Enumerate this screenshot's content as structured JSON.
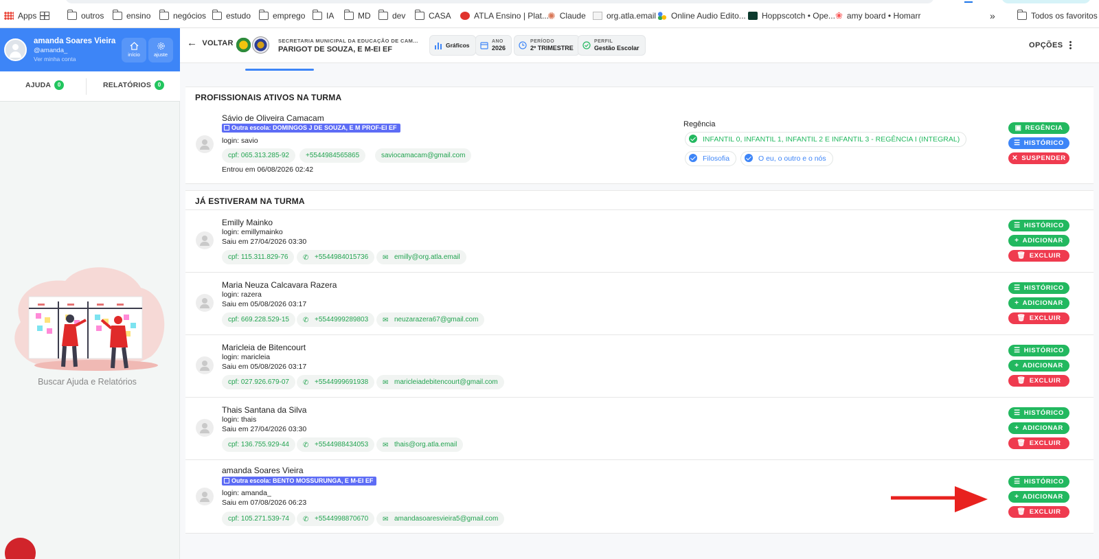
{
  "bookmarks": [
    {
      "label": "Apps",
      "icon": "apps-grid-icon"
    },
    {
      "label": "",
      "icon": "grid-icon"
    },
    {
      "label": "outros",
      "icon": "folder-icon"
    },
    {
      "label": "ensino",
      "icon": "folder-icon"
    },
    {
      "label": "negócios",
      "icon": "folder-icon"
    },
    {
      "label": "estudo",
      "icon": "folder-icon"
    },
    {
      "label": "emprego",
      "icon": "folder-icon"
    },
    {
      "label": "IA",
      "icon": "folder-icon"
    },
    {
      "label": "MD",
      "icon": "folder-icon"
    },
    {
      "label": "dev",
      "icon": "folder-icon"
    },
    {
      "label": "CASA",
      "icon": "folder-icon"
    },
    {
      "label": "ATLA Ensino | Plat...",
      "icon": "atla-icon"
    },
    {
      "label": "Claude",
      "icon": "claude-icon"
    },
    {
      "label": "org.atla.email",
      "icon": "mail-icon"
    },
    {
      "label": "Online Audio Edito...",
      "icon": "audio-icon"
    },
    {
      "label": "Hoppscotch • Ope...",
      "icon": "hoppscotch-icon"
    },
    {
      "label": "amy board • Homarr",
      "icon": "homarr-icon"
    },
    {
      "label": "»",
      "icon": "overflow-icon"
    },
    {
      "label": "Todos os favoritos",
      "icon": "folder-icon"
    }
  ],
  "profile": {
    "name": "amanda Soares Vieira",
    "username": "@amanda_",
    "see_account": "Ver minha conta",
    "home_label": "início",
    "settings_label": "ajuste"
  },
  "help": {
    "help_label": "AJUDA",
    "help_count": "0",
    "reports_label": "RELATÓRIOS",
    "reports_count": "0",
    "search_text": "Buscar Ajuda e Relatórios"
  },
  "header": {
    "back_label": "VOLTAR",
    "org_title": "SECRETARIA MUNICIPAL DA EDUCAÇÃO DE CAM...",
    "org_name": "PARIGOT DE SOUZA, E M-EI EF",
    "chips": {
      "graphs": "Gráficos",
      "year_label": "ANO",
      "year_value": "2026",
      "period_label": "PERÍODO",
      "period_value": "2º TRIMESTRE",
      "profile_label": "PERFIL",
      "profile_value": "Gestão Escolar"
    },
    "options_label": "OPÇÕES"
  },
  "active_section": {
    "title": "PROFISSIONAIS ATIVOS NA TURMA",
    "person": {
      "name": "Sávio de Oliveira Camacam",
      "school_tag": "Outra escola: DOMINGOS J DE SOUZA, E M PROF-EI EF",
      "login": "login: savio",
      "cpf": "cpf: 065.313.285-92",
      "phone": "+5544984565865",
      "email": "saviocamacam@gmail.com",
      "entered": "Entrou em 06/08/2026 02:42",
      "regencia_label": "Regência",
      "regencia_class": "INFANTIL 0, INFANTIL 1, INFANTIL 2 E INFANTIL 3 - REGÊNCIA I (INTEGRAL)",
      "subject_1": "Filosofia",
      "subject_2": "O eu, o outro e o nós",
      "btn_regencia": "REGÊNCIA",
      "btn_historico": "HISTÓRICO",
      "btn_suspender": "SUSPENDER"
    }
  },
  "past_section": {
    "title": "JÁ ESTIVERAM NA TURMA",
    "buttons": {
      "historico": "HISTÓRICO",
      "adicionar": "ADICIONAR",
      "excluir": "EXCLUIR"
    },
    "people": [
      {
        "name": "Emilly Mainko",
        "login": "login: emillymainko",
        "left": "Saiu em 27/04/2026 03:30",
        "cpf": "cpf: 115.311.829-76",
        "phone": "+5544984015736",
        "email": "emilly@org.atla.email"
      },
      {
        "name": "Maria Neuza Calcavara Razera",
        "login": "login: razera",
        "left": "Saiu em 05/08/2026 03:17",
        "cpf": "cpf: 669.228.529-15",
        "phone": "+5544999289803",
        "email": "neuzarazera67@gmail.com"
      },
      {
        "name": "Maricleia de Bitencourt",
        "login": "login: maricleia",
        "left": "Saiu em 05/08/2026 03:17",
        "cpf": "cpf: 027.926.679-07",
        "phone": "+5544999691938",
        "email": "maricleiadebitencourt@gmail.com"
      },
      {
        "name": "Thais Santana da Silva",
        "login": "login: thais",
        "left": "Saiu em 27/04/2026 03:30",
        "cpf": "cpf: 136.755.929-44",
        "phone": "+5544988434053",
        "email": "thais@org.atla.email"
      },
      {
        "name": "amanda Soares Vieira",
        "school_tag": "Outra escola: BENTO MOSSURUNGA, E M-EI EF",
        "login": "login: amanda_",
        "left": "Saiu em 07/08/2026 06:23",
        "cpf": "cpf: 105.271.539-74",
        "phone": "+5544998870670",
        "email": "amandasoaresvieira5@gmail.com"
      }
    ]
  },
  "colors": {
    "brand_blue": "#3d85f7",
    "green": "#22b85f",
    "red": "#ef3b4f",
    "school_tag": "#5d6cf5",
    "annotation_arrow": "#e8221f"
  }
}
